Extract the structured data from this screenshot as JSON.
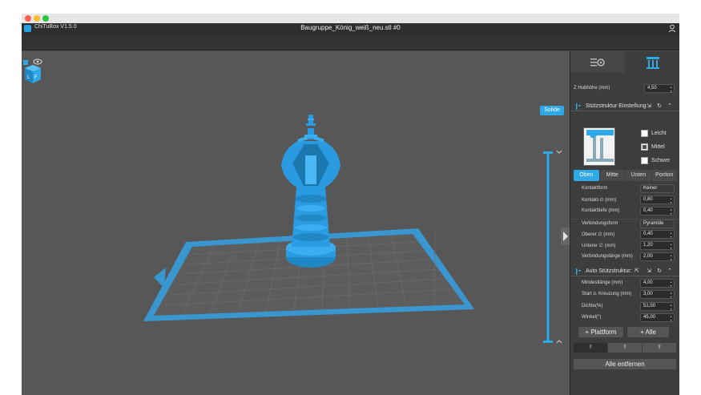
{
  "app": {
    "name": "ChiTuBox V1.5.0",
    "document_title": "Baugruppe_König_weiß_neu.stl #0"
  },
  "viewport": {
    "solid_label": "Solide"
  },
  "panel": {
    "z_lift_label": "Z Hubhöhe (mm)",
    "z_lift_value": "4,50",
    "support_section_title": "Stützstruktur Einstellung",
    "checkboxes": [
      {
        "label": "Leicht",
        "checked": false
      },
      {
        "label": "Mittel",
        "checked": true
      },
      {
        "label": "Schwer",
        "checked": false
      }
    ],
    "tabs": [
      "Oben",
      "Mitte",
      "Unten",
      "Ponton"
    ],
    "active_tab": "Oben",
    "contact_form_label": "Kontaktform",
    "contact_form_value": "Keiner",
    "contact_diam_label": "Kontakt-∅ (mm)",
    "contact_diam_value": "0,80",
    "contact_depth_label": "Kontakttiefe (mm)",
    "contact_depth_value": "0,40",
    "connection_form_label": "Verbindungsform",
    "connection_form_value": "Pyramide",
    "upper_diam_label": "Oberer ∅ (mm)",
    "upper_diam_value": "0,40",
    "lower_diam_label": "Unterer ∅ (mm)",
    "lower_diam_value": "1,20",
    "connection_length_label": "Verbindungslänge (mm)",
    "connection_length_value": "2,00",
    "auto_section_title": "Auto Stützstruktur:",
    "min_length_label": "Mindestlänge (mm)",
    "min_length_value": "4,00",
    "crossing_label": "Start ü. Kreuzung (mm)",
    "crossing_value": "3,00",
    "density_label": "Dichte(%)",
    "density_value": "51,00",
    "angle_label": "Winkel(°)",
    "angle_value": "45,00",
    "platform_button": "+ Plattform",
    "all_button": "+ Alle",
    "remove_all_button": "Alle entfernen"
  },
  "colors": {
    "accent": "#2fa8e8",
    "model": "#29a3e0",
    "background": "#575757",
    "panel": "#3d3d3d"
  },
  "icons": [
    "settings-tab-icon",
    "supports-tab-icon",
    "view-cube-icon",
    "user-icon",
    "chevron-up-icon",
    "chevron-down-icon",
    "expand-arrow-icon"
  ]
}
